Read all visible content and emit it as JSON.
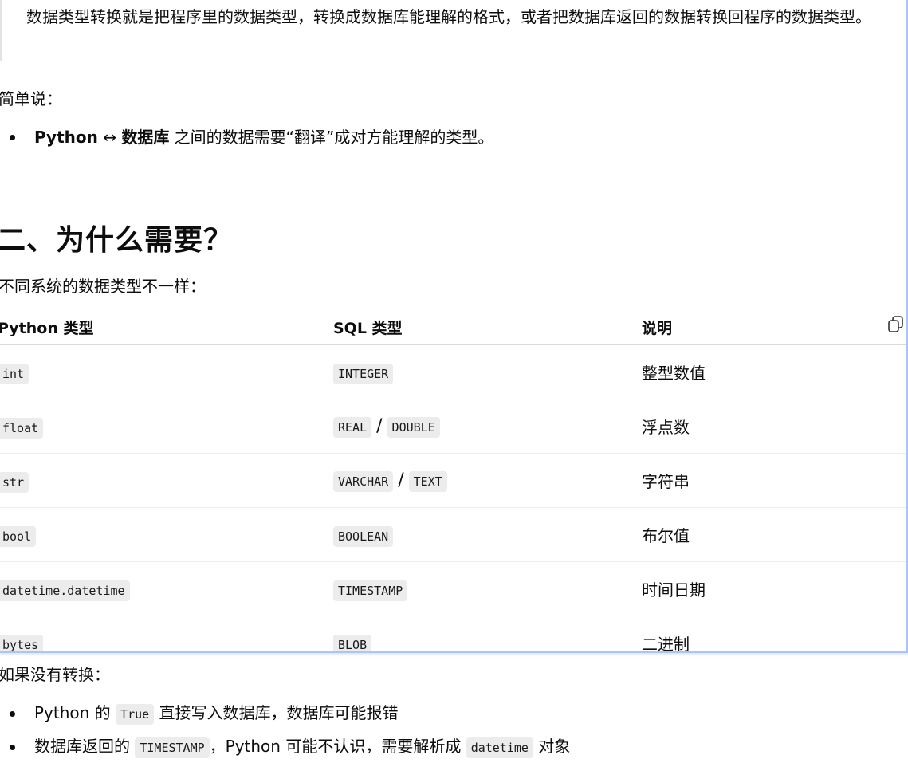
{
  "quote": {
    "text": "数据类型转换就是把程序里的数据类型，转换成数据库能理解的格式，或者把数据库返回的数据转换回程序的数据类型。"
  },
  "summary": {
    "intro": "简单说：",
    "bullet_bold_1": "Python",
    "bullet_arrow": " ↔ ",
    "bullet_bold_2": "数据库",
    "bullet_rest": " 之间的数据需要“翻译”成对方能理解的类型。"
  },
  "section2": {
    "heading": "二、为什么需要？",
    "intro": "不同系统的数据类型不一样：",
    "table": {
      "headers": [
        "Python 类型",
        "SQL 类型",
        "说明"
      ],
      "rows": [
        {
          "py": "int",
          "sql": [
            "INTEGER"
          ],
          "desc": "整型数值"
        },
        {
          "py": "float",
          "sql": [
            "REAL",
            "DOUBLE"
          ],
          "desc": "浮点数"
        },
        {
          "py": "str",
          "sql": [
            "VARCHAR",
            "TEXT"
          ],
          "desc": "字符串"
        },
        {
          "py": "bool",
          "sql": [
            "BOOLEAN"
          ],
          "desc": "布尔值"
        },
        {
          "py": "datetime.datetime",
          "sql": [
            "TIMESTAMP"
          ],
          "desc": "时间日期"
        },
        {
          "py": "bytes",
          "sql": [
            "BLOB"
          ],
          "desc": "二进制"
        }
      ],
      "sql_separator": "/",
      "copy_icon": "copy-icon"
    }
  },
  "no_conversion": {
    "intro": "如果没有转换：",
    "item1_pre": "Python 的 ",
    "item1_code": "True",
    "item1_post": " 直接写入数据库，数据库可能报错",
    "item2_pre": "数据库返回的 ",
    "item2_code": "TIMESTAMP",
    "item2_mid": "，Python 可能不认识，需要解析成 ",
    "item2_code2": "datetime",
    "item2_post": " 对象"
  }
}
